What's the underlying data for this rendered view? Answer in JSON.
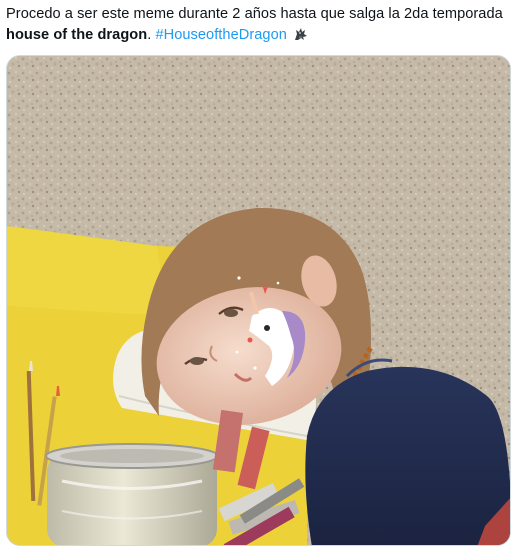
{
  "tweet": {
    "text_line1": "Procedo a ser este meme durante 2 años hasta que salga la 2da temporada",
    "text_bold": "house of the dragon",
    "text_period": ".",
    "hashtag": "#HouseoftheDragon",
    "hashtag_emoji_icon": "dragon-emoji-icon"
  },
  "media": {
    "icon": "meme-photo"
  },
  "colors": {
    "text": "#0f1419",
    "hashtag": "#1d9bf0",
    "border": "#cfd9de"
  }
}
